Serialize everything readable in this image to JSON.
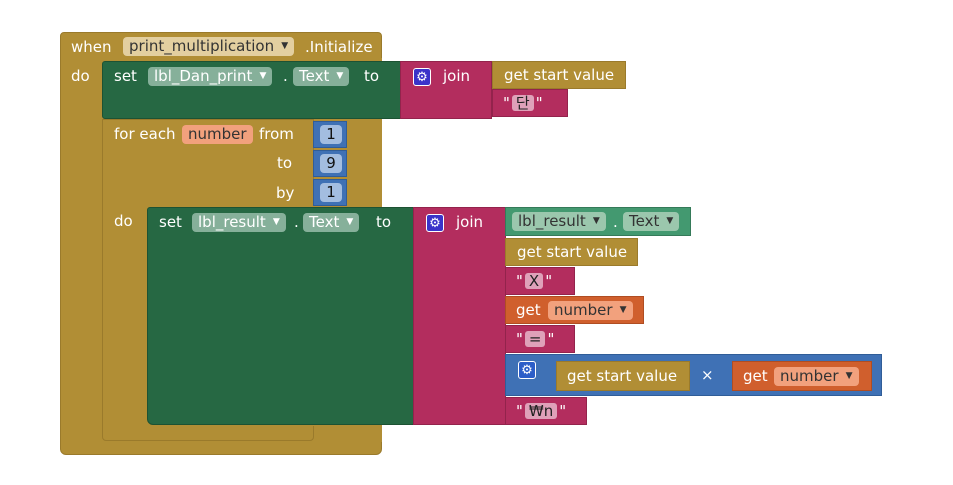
{
  "event": {
    "when": "when",
    "component": "print_multiplication",
    "event_name": ".Initialize",
    "do": "do"
  },
  "set1": {
    "set": "set",
    "component": "lbl_Dan_print",
    "dot": ".",
    "property": "Text",
    "to": "to"
  },
  "join1": {
    "label": "join",
    "item1": "get start value",
    "item2_text": "단"
  },
  "loop": {
    "for_each": "for each",
    "var": "number",
    "from": "from",
    "from_val": "1",
    "to": "to",
    "to_val": "9",
    "by": "by",
    "by_val": "1",
    "do": "do"
  },
  "set2": {
    "set": "set",
    "component": "lbl_result",
    "dot": ".",
    "property": "Text",
    "to": "to"
  },
  "join2": {
    "label": "join",
    "prop_component": "lbl_result",
    "prop_dot": ".",
    "prop_name": "Text",
    "get_start": "get start value",
    "text_x": "X",
    "get_label": "get",
    "get_var": "number",
    "text_eq": "=",
    "mult_left": "get start value",
    "mult_op": "×",
    "mult_get": "get",
    "mult_var": "number",
    "text_nl": "₩n"
  },
  "quote_mark": "\"",
  "icons": {
    "gear": "gear-icon",
    "dropdown": "chevron-down-icon"
  },
  "colors": {
    "event": "#b18e35",
    "component": "#266843",
    "text": "#b32d5e",
    "math": "#3f71b5",
    "variable": "#d05f2d",
    "property": "#439970"
  }
}
